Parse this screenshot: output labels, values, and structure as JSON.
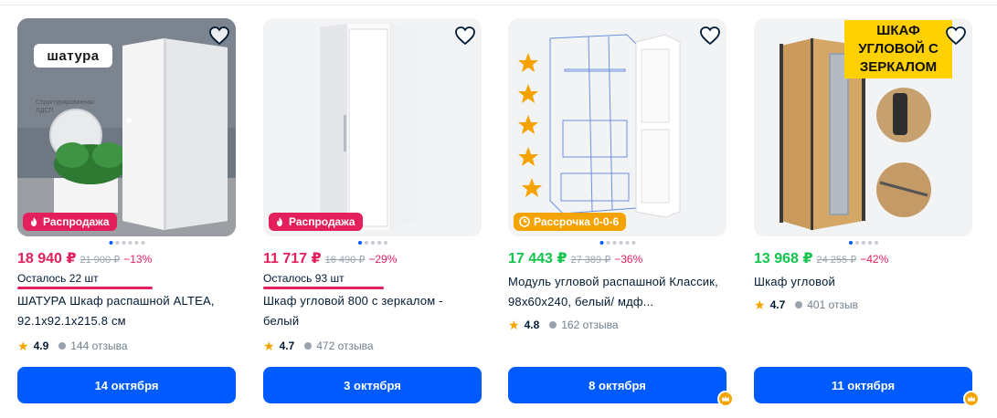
{
  "products": [
    {
      "price": "18 940 ₽",
      "price_color": "#e3205c",
      "old_price": "21 900 ₽",
      "discount": "−13%",
      "badge": "Распродажа",
      "stock": "Осталось 22 шт",
      "title": "ШАТУРА Шкаф распашной ALTEA, 92.1x92.1x215.8 см",
      "rating": "4.9",
      "reviews": "144 отзыва",
      "delivery": "14 октября",
      "brand_logo": "шатура",
      "brand_note": "Структурированная ЛДСП"
    },
    {
      "price": "11 717 ₽",
      "price_color": "#e3205c",
      "old_price": "16 490 ₽",
      "discount": "−29%",
      "badge": "Распродажа",
      "stock": "Осталось 93 шт",
      "title": "Шкаф угловой 800 с зеркалом - белый",
      "rating": "4.7",
      "reviews": "472 отзыва",
      "delivery": "3 октября"
    },
    {
      "price": "17 443 ₽",
      "price_color": "#10c44c",
      "old_price": "27 389 ₽",
      "discount": "−36%",
      "badge": "Рассрочка 0-0-6",
      "title": "Модуль угловой распашной Классик, 98x60x240, белый/ мдф...",
      "rating": "4.8",
      "reviews": "162 отзыва",
      "delivery": "8 октября"
    },
    {
      "price": "13 968 ₽",
      "price_color": "#10c44c",
      "old_price": "24 255 ₽",
      "discount": "−42%",
      "title": "Шкаф угловой",
      "rating": "4.7",
      "reviews": "401 отзыв",
      "delivery": "11 октября",
      "promo_text": "ШКАФ УГЛОВОЙ С ЗЕРКАЛОМ"
    }
  ]
}
